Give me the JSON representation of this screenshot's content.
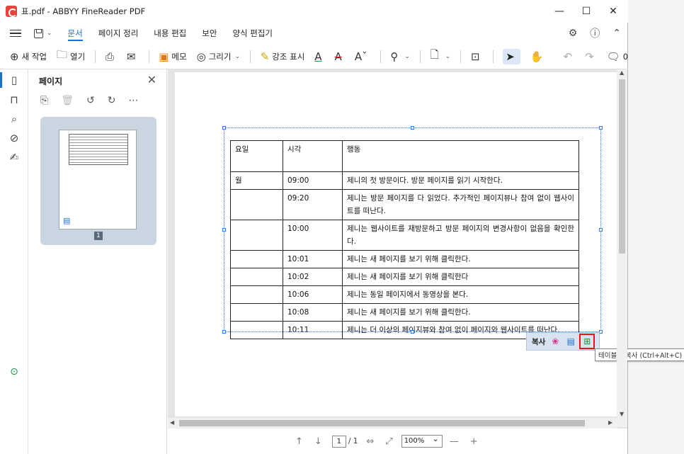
{
  "window": {
    "title": "표.pdf - ABBYY FineReader PDF",
    "minimize": "—",
    "maximize": "☐",
    "close": "✕"
  },
  "menu": {
    "tabs": [
      "문서",
      "페이지 정리",
      "내용 편집",
      "보안",
      "양식 편집기"
    ],
    "active_tab": "문서"
  },
  "toolbar": {
    "new_task": "새 작업",
    "open": "열기",
    "memo": "메모",
    "draw": "그리기",
    "highlight": "강조 표시",
    "comment_count": "0"
  },
  "panel": {
    "title": "페이지",
    "page_number": "1"
  },
  "table": {
    "headers": [
      "요일",
      "시각",
      "행동"
    ],
    "rows": [
      {
        "day": "월",
        "time": "09:00",
        "action": "제니의 첫 방문이다. 방문 페이지를 읽기 시작한다."
      },
      {
        "day": "",
        "time": "09:20",
        "action": "제니는 방문 페이지를 다 읽었다. 추가적인 페이지뷰나 참여 없이 웹사이트를 떠난다."
      },
      {
        "day": "",
        "time": "10:00",
        "action": "제니는 웹사이트를 재방문하고 방문 페이지의 변경사항이 없음을 확인한다."
      },
      {
        "day": "",
        "time": "10:01",
        "action": "제니는 새 페이지를 보기 위해 클릭한다."
      },
      {
        "day": "",
        "time": "10:02",
        "action": "제니는 새 페이지를 보기 위해 클릭한다"
      },
      {
        "day": "",
        "time": "10:06",
        "action": "제니는 동일 페이지에서 동영상을 본다."
      },
      {
        "day": "",
        "time": "10:08",
        "action": "제니는 새 페이지를 보기 위해 클릭한다."
      },
      {
        "day": "",
        "time": "10:11",
        "action": "제니는 더 이상의 페이지뷰와 참여 없이 페이지와 웹사이트를 떠난다."
      }
    ]
  },
  "copybar": {
    "copy_label": "복사",
    "tooltip": "테이블로 복사 (Ctrl+Alt+C)"
  },
  "status": {
    "current_page": "1",
    "total_pages": "/ 1",
    "zoom": "100%"
  },
  "colors": {
    "accent": "#1b6fd1",
    "highlight_box": "#e11111"
  }
}
